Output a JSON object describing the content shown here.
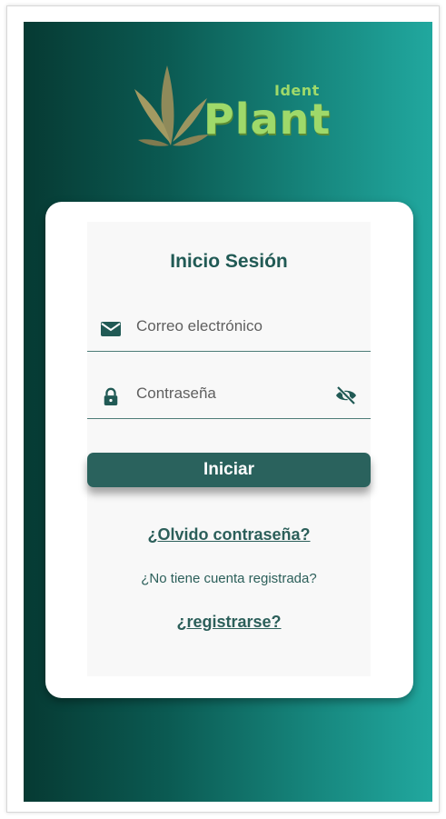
{
  "logo": {
    "brand_small": "Ident",
    "brand_large": "Plant"
  },
  "login": {
    "title": "Inicio Sesión",
    "email_placeholder": "Correo electrónico",
    "password_placeholder": "Contraseña",
    "submit_label": "Iniciar",
    "forgot_label": "¿Olvido contraseña?",
    "no_account_text": "¿No tiene cuenta registrada?",
    "register_label": "¿registrarse?"
  },
  "icons": {
    "email": "mail-icon",
    "password": "lock-icon",
    "visibility": "eye-off-icon"
  },
  "colors": {
    "primary": "#2a625d",
    "accent_text": "#215a55",
    "logo_green": "#9fd96a",
    "gradient_start": "#063a33",
    "gradient_end": "#21a89f"
  }
}
